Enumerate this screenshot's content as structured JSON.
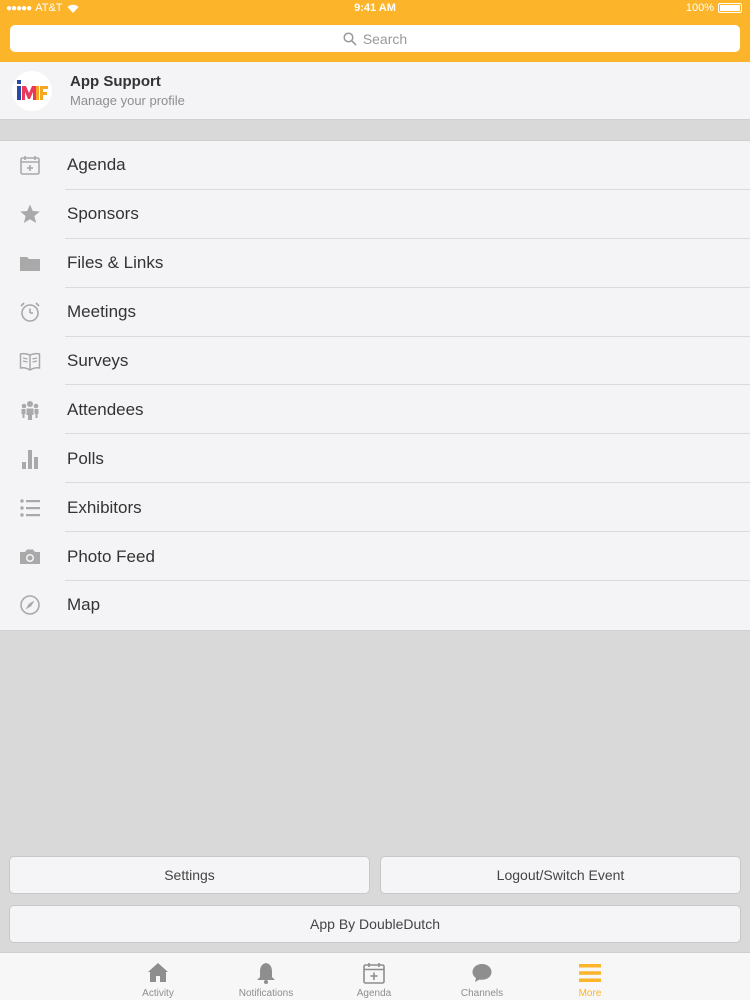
{
  "status": {
    "carrier": "AT&T",
    "time": "9:41 AM",
    "battery": "100%"
  },
  "search": {
    "placeholder": "Search"
  },
  "profile": {
    "name": "App Support",
    "subtitle": "Manage your profile"
  },
  "menu": [
    {
      "label": "Agenda",
      "icon": "calendar-icon"
    },
    {
      "label": "Sponsors",
      "icon": "star-icon"
    },
    {
      "label": "Files & Links",
      "icon": "folder-icon"
    },
    {
      "label": "Meetings",
      "icon": "alarm-clock-icon"
    },
    {
      "label": "Surveys",
      "icon": "open-book-icon"
    },
    {
      "label": "Attendees",
      "icon": "people-icon"
    },
    {
      "label": "Polls",
      "icon": "bar-chart-icon"
    },
    {
      "label": "Exhibitors",
      "icon": "list-icon"
    },
    {
      "label": "Photo Feed",
      "icon": "camera-icon"
    },
    {
      "label": "Map",
      "icon": "compass-icon"
    }
  ],
  "buttons": {
    "settings": "Settings",
    "logout": "Logout/Switch Event",
    "app_by": "App By DoubleDutch"
  },
  "tabs": [
    {
      "label": "Activity",
      "icon": "home-icon"
    },
    {
      "label": "Notifications",
      "icon": "bell-icon"
    },
    {
      "label": "Agenda",
      "icon": "calendar-icon"
    },
    {
      "label": "Channels",
      "icon": "chat-bubble-icon"
    },
    {
      "label": "More",
      "icon": "menu-icon",
      "active": true
    }
  ],
  "colors": {
    "accent": "#fcb42b",
    "icon_gray": "#a9a9a9",
    "background": "#d9d9d9"
  }
}
